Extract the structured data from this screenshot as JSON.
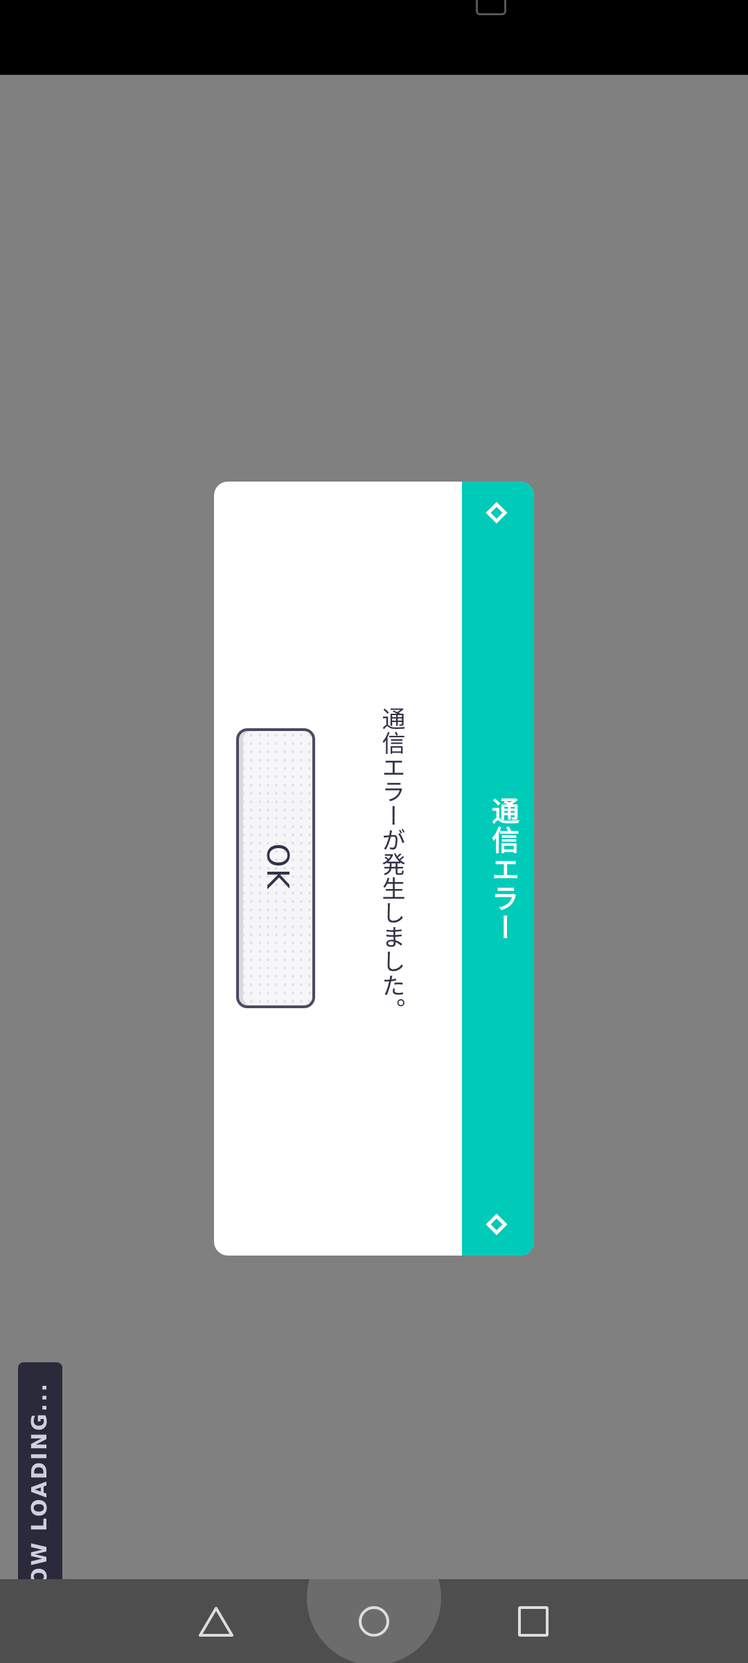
{
  "dialog": {
    "title": "通信エラー",
    "message": "通信エラーが発生しました。",
    "ok_label": "OK"
  },
  "loading": {
    "text": "NOW LOADING..."
  },
  "colors": {
    "accent": "#00cbb9",
    "overlay": "#808080",
    "text_dark": "#333349"
  },
  "nav": {
    "back_icon": "back-triangle-icon",
    "home_icon": "home-circle-icon",
    "recents_icon": "recents-square-icon"
  }
}
